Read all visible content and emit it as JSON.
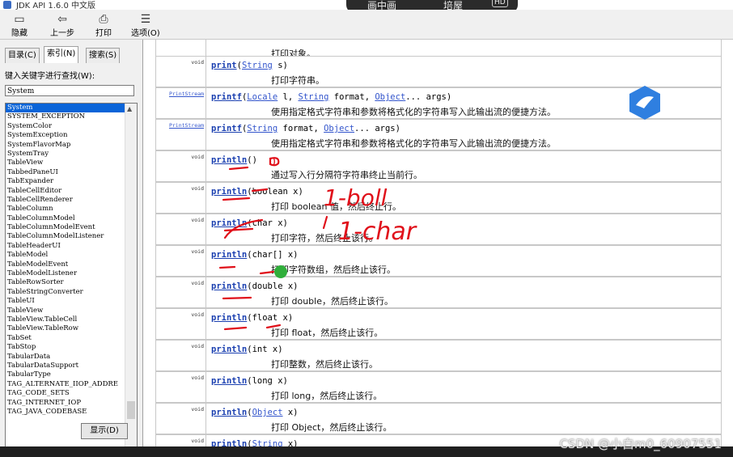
{
  "window": {
    "title": "JDK API 1.6.0 中文版"
  },
  "overlay": {
    "left_text": "画中画",
    "right_text": "培屋",
    "badge": "HD"
  },
  "toolbar": {
    "buttons": [
      {
        "label": "隐藏",
        "icon": "hide-icon"
      },
      {
        "label": "上一步",
        "icon": "back-arrow-icon"
      },
      {
        "label": "打印",
        "icon": "print-icon"
      },
      {
        "label": "选项(O)",
        "icon": "options-icon"
      }
    ]
  },
  "left_pane": {
    "tabs": [
      "目录(C)",
      "索引(N)",
      "搜索(S)"
    ],
    "active_tab": "索引(N)",
    "search_label": "键入关键字进行查找(W):",
    "search_value": "System",
    "list_items": [
      "System",
      "SYSTEM_EXCEPTION",
      "SystemColor",
      "SystemException",
      "SystemFlavorMap",
      "SystemTray",
      "TableView",
      "TabbedPaneUI",
      "TabExpander",
      "TableCellEditor",
      "TableCellRenderer",
      "TableColumn",
      "TableColumnModel",
      "TableColumnModelEvent",
      "TableColumnModelListener",
      "TableHeaderUI",
      "TableModel",
      "TableModelEvent",
      "TableModelListener",
      "TableRowSorter",
      "TableStringConverter",
      "TableUI",
      "TableView",
      "TableView.TableCell",
      "TableView.TableRow",
      "TabSet",
      "TabStop",
      "TabularData",
      "TabularDataSupport",
      "TabularType",
      "TAG_ALTERNATE_IIOP_ADDRE",
      "TAG_CODE_SETS",
      "TAG_INTERNET_IOP",
      "TAG_JAVA_CODEBASE"
    ],
    "selected_index": 0,
    "display_button": "显示(D)"
  },
  "content": {
    "rows": [
      {
        "type": "",
        "type_link": false,
        "method": "",
        "params": [],
        "desc": "打印对象。"
      },
      {
        "type": "void",
        "type_link": false,
        "method": "print",
        "params": [
          {
            "t": "String",
            "link": true
          },
          {
            "t": " s)",
            "link": false
          }
        ],
        "desc": "打印字符串。"
      },
      {
        "type": "PrintStream",
        "type_link": true,
        "method": "printf",
        "params": [
          {
            "t": "Locale",
            "link": true
          },
          {
            "t": " l, ",
            "link": false
          },
          {
            "t": "String",
            "link": true
          },
          {
            "t": " format, ",
            "link": false
          },
          {
            "t": "Object",
            "link": true
          },
          {
            "t": "... args)",
            "link": false
          }
        ],
        "desc": "使用指定格式字符串和参数将格式化的字符串写入此输出流的便捷方法。"
      },
      {
        "type": "PrintStream",
        "type_link": true,
        "method": "printf",
        "params": [
          {
            "t": "String",
            "link": true
          },
          {
            "t": " format, ",
            "link": false
          },
          {
            "t": "Object",
            "link": true
          },
          {
            "t": "... args)",
            "link": false
          }
        ],
        "desc": "使用指定格式字符串和参数将格式化的字符串写入此输出流的便捷方法。"
      },
      {
        "type": "void",
        "type_link": false,
        "method": "println",
        "params": [
          {
            "t": ")",
            "link": false
          }
        ],
        "desc": "通过写入行分隔符字符串终止当前行。"
      },
      {
        "type": "void",
        "type_link": false,
        "method": "println",
        "params": [
          {
            "t": "boolean x)",
            "link": false
          }
        ],
        "desc": "打印 boolean 值，然后终止行。"
      },
      {
        "type": "void",
        "type_link": false,
        "method": "println",
        "params": [
          {
            "t": "char x)",
            "link": false
          }
        ],
        "desc": "打印字符，然后终止该行。"
      },
      {
        "type": "void",
        "type_link": false,
        "method": "println",
        "params": [
          {
            "t": "char[] x)",
            "link": false
          }
        ],
        "desc": "打印字符数组，然后终止该行。"
      },
      {
        "type": "void",
        "type_link": false,
        "method": "println",
        "params": [
          {
            "t": "double x)",
            "link": false
          }
        ],
        "desc": "打印 double，然后终止该行。"
      },
      {
        "type": "void",
        "type_link": false,
        "method": "println",
        "params": [
          {
            "t": "float x)",
            "link": false
          }
        ],
        "desc": "打印 float，然后终止该行。"
      },
      {
        "type": "void",
        "type_link": false,
        "method": "println",
        "params": [
          {
            "t": "int x)",
            "link": false
          }
        ],
        "desc": "打印整数，然后终止该行。"
      },
      {
        "type": "void",
        "type_link": false,
        "method": "println",
        "params": [
          {
            "t": "long x)",
            "link": false
          }
        ],
        "desc": "打印 long，然后终止该行。"
      },
      {
        "type": "void",
        "type_link": false,
        "method": "println",
        "params": [
          {
            "t": "Object",
            "link": true
          },
          {
            "t": " x)",
            "link": false
          }
        ],
        "desc": "打印 Object，然后终止该行。"
      },
      {
        "type": "void",
        "type_link": false,
        "method": "println",
        "params": [
          {
            "t": "String",
            "link": true
          },
          {
            "t": " x)",
            "link": false
          }
        ],
        "desc": ""
      }
    ]
  },
  "annotations": {
    "char_note": "1-char",
    "boolean_note": "1-boll",
    "zero_note": "0"
  },
  "watermark": "CSDN @小白m0_60907551",
  "colors": {
    "link": "#3355cc",
    "method": "#1a3fb0",
    "selection": "#0a64d8",
    "annotation": "#e0101a"
  }
}
